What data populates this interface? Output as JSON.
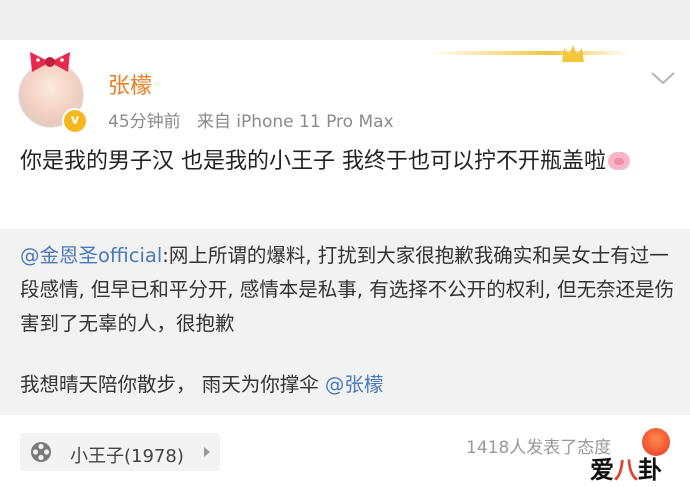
{
  "post": {
    "username": "张檬",
    "time": "45分钟前",
    "source": "来自 iPhone 11 Pro Max",
    "text": "你是我的男子汉  也是我的小王子  我终于也可以拧不开瓶盖啦",
    "verified_badge": "v",
    "emoji": "pig-face-icon"
  },
  "repost": {
    "mention": "@金恩圣official",
    "text": ":网上所谓的爆料, 打扰到大家很抱歉我确实和吴女士有过一段感情, 但早已和平分开, 感情本是私事, 有选择不公开的权利, 但无奈还是伤害到了无辜的人，很抱歉",
    "line2_text": "我想晴天陪你散步，  雨天为你撑伞 ",
    "line2_mention": "@张檬"
  },
  "footer": {
    "topic_label": "小王子(1978)",
    "comment_count": "1418人发表了态度"
  },
  "watermark": {
    "left": "爱",
    "mid": "八",
    "right": "卦"
  },
  "colors": {
    "username": "#ea7d25",
    "mention": "#4a7ab8",
    "badge": "#f5b71e",
    "repost_bg": "#f2f2f2"
  }
}
